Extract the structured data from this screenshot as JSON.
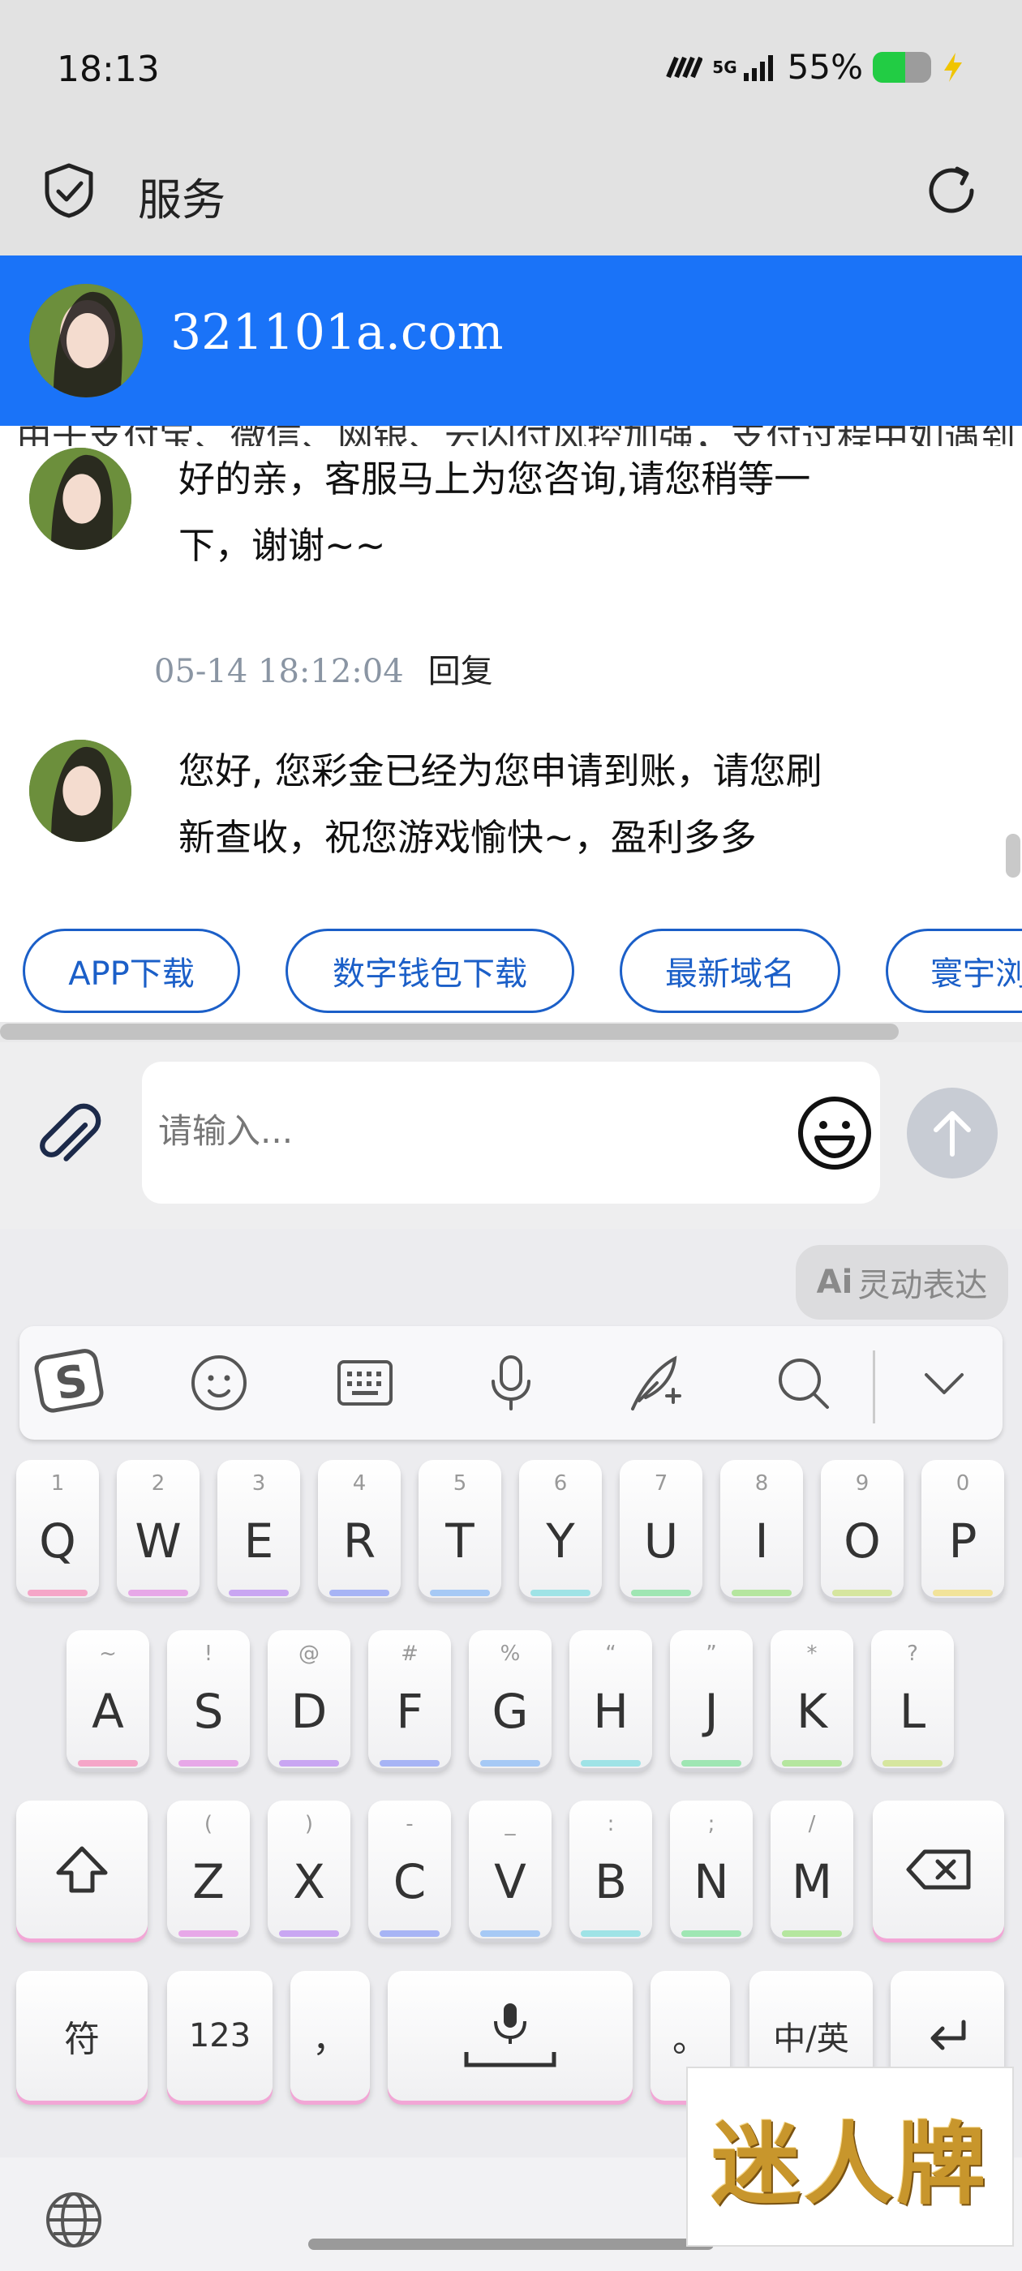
{
  "status_bar": {
    "time": "18:13",
    "network": "5G",
    "battery_percent": "55%",
    "battery_level": 0.55
  },
  "header": {
    "title": "服务"
  },
  "banner": {
    "domain": "321101a.com"
  },
  "marquee": {
    "text": "由于支付宝、微信、网银、云闪付风控加强，支付过程中如遇到"
  },
  "messages": [
    {
      "text": "好的亲，客服马上为您咨询,请您稍等一下，谢谢~~",
      "timestamp": "05-14 18:12:04",
      "reply_label": "回复"
    },
    {
      "text": "您好, 您彩金已经为您申请到账，请您刷新查收，祝您游戏愉快~，盈利多多"
    }
  ],
  "quick_links": [
    "APP下载",
    "数字钱包下载",
    "最新域名",
    "寰宇浏"
  ],
  "input": {
    "placeholder": "请输入..."
  },
  "keyboard": {
    "ai_label": "Ai",
    "ai_text": "灵动表达",
    "row1": [
      {
        "hint": "1",
        "key": "Q"
      },
      {
        "hint": "2",
        "key": "W"
      },
      {
        "hint": "3",
        "key": "E"
      },
      {
        "hint": "4",
        "key": "R"
      },
      {
        "hint": "5",
        "key": "T"
      },
      {
        "hint": "6",
        "key": "Y"
      },
      {
        "hint": "7",
        "key": "U"
      },
      {
        "hint": "8",
        "key": "I"
      },
      {
        "hint": "9",
        "key": "O"
      },
      {
        "hint": "0",
        "key": "P"
      }
    ],
    "row2": [
      {
        "hint": "~",
        "key": "A"
      },
      {
        "hint": "!",
        "key": "S"
      },
      {
        "hint": "@",
        "key": "D"
      },
      {
        "hint": "#",
        "key": "F"
      },
      {
        "hint": "%",
        "key": "G"
      },
      {
        "hint": "“",
        "key": "H"
      },
      {
        "hint": "”",
        "key": "J"
      },
      {
        "hint": "*",
        "key": "K"
      },
      {
        "hint": "?",
        "key": "L"
      }
    ],
    "row3": [
      {
        "hint": "(",
        "key": "Z"
      },
      {
        "hint": ")",
        "key": "X"
      },
      {
        "hint": "-",
        "key": "C"
      },
      {
        "hint": "_",
        "key": "V"
      },
      {
        "hint": ":",
        "key": "B"
      },
      {
        "hint": ";",
        "key": "N"
      },
      {
        "hint": "/",
        "key": "M"
      }
    ],
    "symbols_key": "符",
    "numbers_key": "123",
    "comma_key": "，",
    "period_key": "。",
    "lang_key": "中/英",
    "glow_colors": [
      "#f5a6c8",
      "#e7a8e8",
      "#c9a6f2",
      "#a7b4f5",
      "#a6c9f5",
      "#9fe3e6",
      "#9fe6b3",
      "#b5e69f",
      "#d6e69f",
      "#f2e39a"
    ]
  },
  "watermark": {
    "text": "迷人牌"
  },
  "colors": {
    "banner": "#1a73f8",
    "chip": "#1b5fc8"
  }
}
